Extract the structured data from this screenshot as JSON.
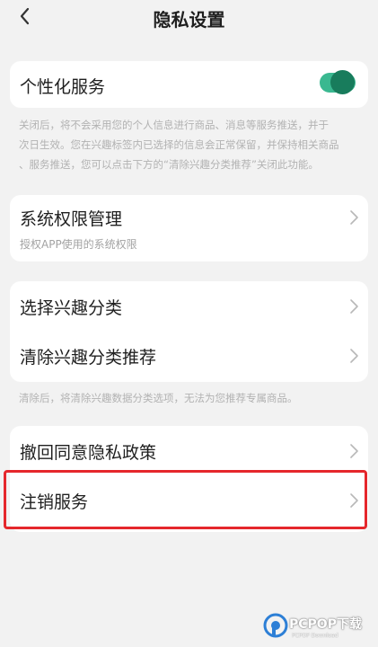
{
  "header": {
    "title": "隐私设置",
    "back_icon": "chevron-left-icon"
  },
  "personalization": {
    "label": "个性化服务",
    "toggle_on": true,
    "note_lines": [
      "关闭后，将不会采用您的个人信息进行商品、消息等服务推送，并于",
      "次日生效。您在兴趣标签内已选择的信息会正常保留，并保持相关商品",
      "、服务推送，您可以点击下方的“清除兴趣分类推荐”关闭此功能。"
    ]
  },
  "system_permissions": {
    "label": "系统权限管理",
    "sub": "授权APP使用的系统权限"
  },
  "interest": {
    "select_label": "选择兴趣分类",
    "clear_label": "清除兴趣分类推荐",
    "note": "清除后，将清除兴趣数据分类选项，无法为您推荐专属商品。"
  },
  "account": {
    "withdraw_label": "撤回同意隐私政策",
    "cancel_label": "注销服务"
  },
  "watermark": {
    "text": "PCPOP下载",
    "sub": "PCPOP Download"
  },
  "colors": {
    "toggle_track": "#3ab890",
    "toggle_knob": "#187c5c",
    "highlight": "#e5272c",
    "background": "#f2f2f2"
  }
}
